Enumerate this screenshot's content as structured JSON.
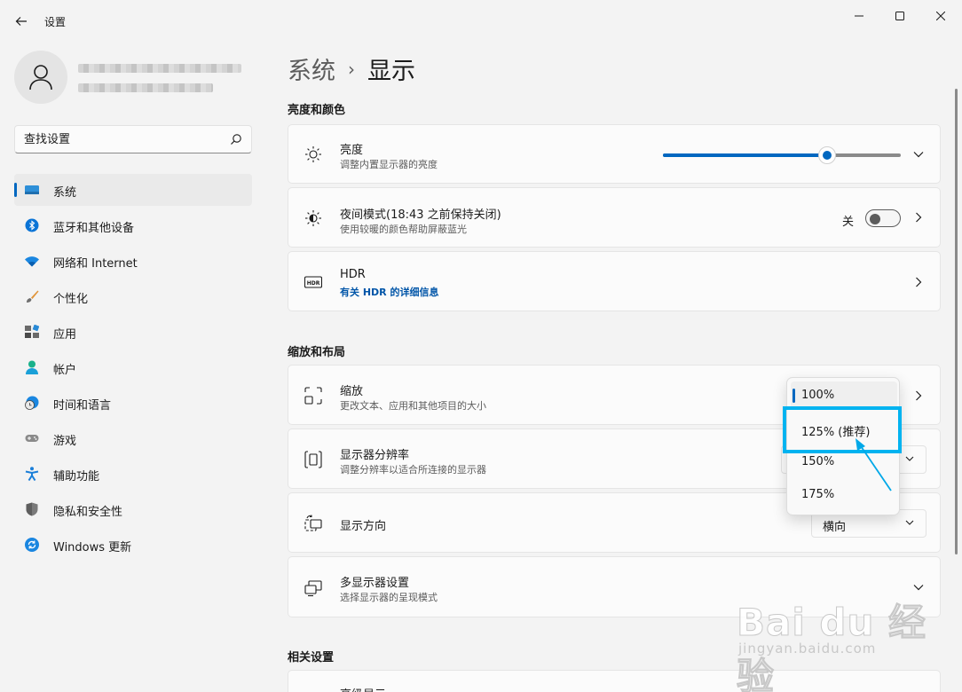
{
  "window": {
    "title": "设置"
  },
  "user": {
    "name": "",
    "email": ""
  },
  "search": {
    "placeholder": "查找设置"
  },
  "nav": {
    "items": [
      {
        "label": "系统",
        "icon": "system-icon"
      },
      {
        "label": "蓝牙和其他设备",
        "icon": "bluetooth-icon"
      },
      {
        "label": "网络和 Internet",
        "icon": "wifi-icon"
      },
      {
        "label": "个性化",
        "icon": "brush-icon"
      },
      {
        "label": "应用",
        "icon": "apps-icon"
      },
      {
        "label": "帐户",
        "icon": "account-icon"
      },
      {
        "label": "时间和语言",
        "icon": "clock-globe-icon"
      },
      {
        "label": "游戏",
        "icon": "gamepad-icon"
      },
      {
        "label": "辅助功能",
        "icon": "accessibility-icon"
      },
      {
        "label": "隐私和安全性",
        "icon": "shield-icon"
      },
      {
        "label": "Windows 更新",
        "icon": "update-icon"
      }
    ],
    "active_index": 0
  },
  "breadcrumb": {
    "parent": "系统",
    "separator": "›",
    "current": "显示"
  },
  "sections": {
    "brightness_color": "亮度和颜色",
    "scale_layout": "缩放和布局",
    "related": "相关设置"
  },
  "brightness": {
    "title": "亮度",
    "subtitle": "调整内置显示器的亮度",
    "level_fraction": 0.69
  },
  "night_light": {
    "title": "夜间模式(18:43 之前保持关闭)",
    "subtitle": "使用较暖的颜色帮助屏蔽蓝光",
    "state_label": "关"
  },
  "hdr": {
    "title": "HDR",
    "link": "有关 HDR 的详细信息"
  },
  "scale": {
    "title": "缩放",
    "subtitle": "更改文本、应用和其他项目的大小",
    "options": [
      "100%",
      "125% (推荐)",
      "150%",
      "175%"
    ],
    "selected_index": 0,
    "highlighted_index": 1
  },
  "resolution": {
    "title": "显示器分辨率",
    "subtitle": "调整分辨率以适合所连接的显示器"
  },
  "orientation": {
    "title": "显示方向",
    "value": "横向"
  },
  "multi_display": {
    "title": "多显示器设置",
    "subtitle": "选择显示器的呈现模式"
  },
  "advanced_display": {
    "title": "高级显示"
  },
  "watermark": {
    "main": "Bai du 经验",
    "sub": "jingyan.baidu.com"
  },
  "colors": {
    "accent": "#0067c0",
    "highlight": "#00b3f0"
  }
}
